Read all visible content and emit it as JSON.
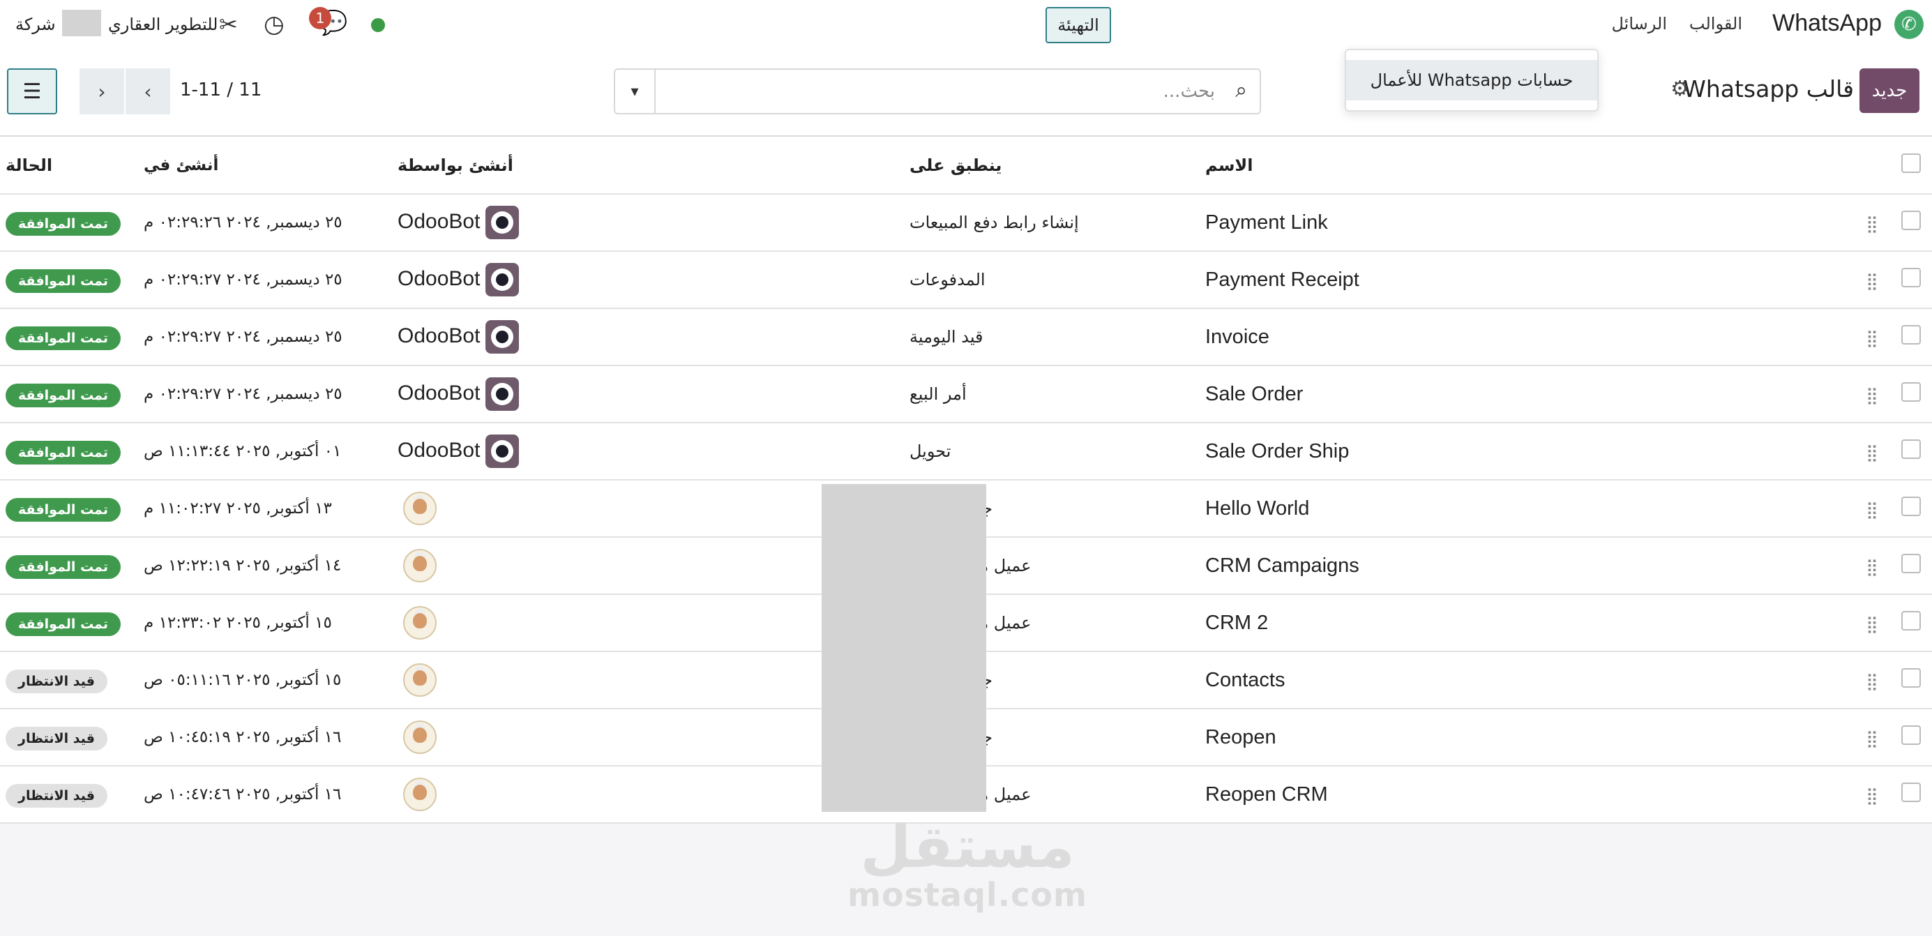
{
  "topbar": {
    "app_name": "WhatsApp",
    "menus": [
      "القوالب",
      "الرسائل",
      "التهيئة"
    ],
    "company_prefix": "شركة",
    "company_suffix": "للتطوير العقاري",
    "messages_badge": "1"
  },
  "config_dropdown": {
    "items": [
      "حسابات Whatsapp للأعمال"
    ]
  },
  "control": {
    "new_label": "جديد",
    "title": "قالب Whatsapp",
    "search_placeholder": "بحث...",
    "pager": "1-11 / 11"
  },
  "table": {
    "columns": {
      "name": "الاسم",
      "applies_to": "ينطبق على",
      "created_by": "أنشئ بواسطة",
      "created_on": "أنشئ في",
      "status": "الحالة"
    },
    "rows": [
      {
        "name": "Payment Link",
        "applies_to": "إنشاء رابط دفع المبيعات",
        "created_by": "OdooBot",
        "avatar": "bot",
        "created_on": "٢٥ ديسمبر, ٢٠٢٤ ٠٢:٢٩:٢٦ م",
        "status": "تمت الموافقة",
        "status_kind": "ok"
      },
      {
        "name": "Payment Receipt",
        "applies_to": "المدفوعات",
        "created_by": "OdooBot",
        "avatar": "bot",
        "created_on": "٢٥ ديسمبر, ٢٠٢٤ ٠٢:٢٩:٢٧ م",
        "status": "تمت الموافقة",
        "status_kind": "ok"
      },
      {
        "name": "Invoice",
        "applies_to": "قيد اليومية",
        "created_by": "OdooBot",
        "avatar": "bot",
        "created_on": "٢٥ ديسمبر, ٢٠٢٤ ٠٢:٢٩:٢٧ م",
        "status": "تمت الموافقة",
        "status_kind": "ok"
      },
      {
        "name": "Sale Order",
        "applies_to": "أمر البيع",
        "created_by": "OdooBot",
        "avatar": "bot",
        "created_on": "٢٥ ديسمبر, ٢٠٢٤ ٠٢:٢٩:٢٧ م",
        "status": "تمت الموافقة",
        "status_kind": "ok"
      },
      {
        "name": "Sale Order Ship",
        "applies_to": "تحويل",
        "created_by": "OdooBot",
        "avatar": "bot",
        "created_on": "٠١ أكتوبر, ٢٠٢٥ ١١:١٣:٤٤ ص",
        "status": "تمت الموافقة",
        "status_kind": "ok"
      },
      {
        "name": "Hello World",
        "applies_to": "جهة الاتصال",
        "created_by": "",
        "avatar": "user",
        "created_on": "١٣ أكتوبر, ٢٠٢٥ ١١:٠٢:٢٧ م",
        "status": "تمت الموافقة",
        "status_kind": "ok"
      },
      {
        "name": "CRM Campaigns",
        "applies_to": "عميل مهتم/فرصة",
        "created_by": "",
        "avatar": "user",
        "created_on": "١٤ أكتوبر, ٢٠٢٥ ١٢:٢٢:١٩ ص",
        "status": "تمت الموافقة",
        "status_kind": "ok"
      },
      {
        "name": "CRM 2",
        "applies_to": "عميل مهتم/فرصة",
        "created_by": "",
        "avatar": "user",
        "created_on": "١٥ أكتوبر, ٢٠٢٥ ١٢:٣٣:٠٢ م",
        "status": "تمت الموافقة",
        "status_kind": "ok"
      },
      {
        "name": "Contacts",
        "applies_to": "جهة الاتصال",
        "created_by": "",
        "avatar": "user",
        "created_on": "١٥ أكتوبر, ٢٠٢٥ ٠٥:١١:١٦ ص",
        "status": "قيد الانتظار",
        "status_kind": "wait"
      },
      {
        "name": "Reopen",
        "applies_to": "جهة الاتصال",
        "created_by": "",
        "avatar": "user",
        "created_on": "١٦ أكتوبر, ٢٠٢٥ ١٠:٤٥:١٩ ص",
        "status": "قيد الانتظار",
        "status_kind": "wait"
      },
      {
        "name": "Reopen CRM",
        "applies_to": "عميل مهتم/فرصة",
        "created_by": "",
        "avatar": "user",
        "created_on": "١٦ أكتوبر, ٢٠٢٥ ١٠:٤٧:٤٦ ص",
        "status": "قيد الانتظار",
        "status_kind": "wait"
      }
    ]
  },
  "watermark": {
    "arabic": "مستقل",
    "latin": "mostaql.com"
  }
}
